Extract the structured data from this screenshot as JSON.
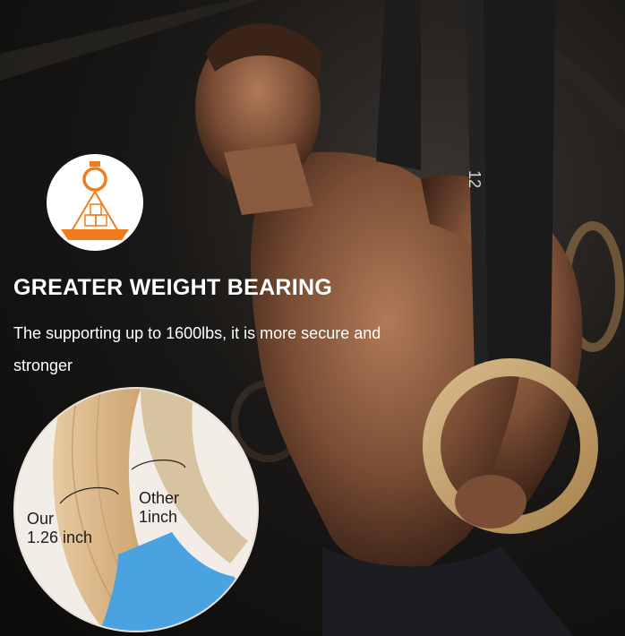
{
  "icon": {
    "name": "ring-weight-icon",
    "accent_color": "#f07d1d"
  },
  "headline": "GREATER WEIGHT BEARING",
  "description": "The supporting up to 1600lbs, it is more secure and stronger",
  "strap_marking": "12",
  "comparison": {
    "our_label": "Our",
    "our_value": "1.26 inch",
    "other_label": "Other",
    "other_value": "1inch",
    "tape_color": "#4aa3e0"
  }
}
